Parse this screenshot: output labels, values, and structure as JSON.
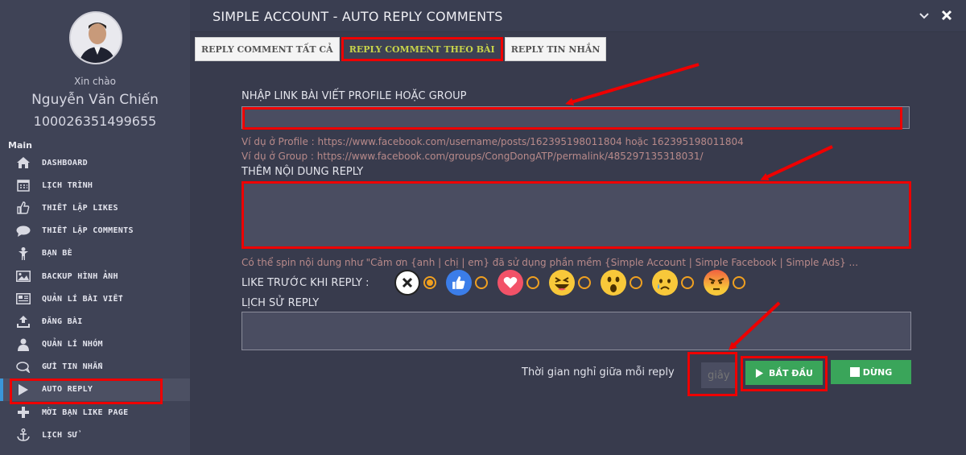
{
  "sidebar": {
    "greeting": "Xin chào",
    "user_name": "Nguyễn Văn Chiến",
    "user_id": "100026351499655",
    "section": "Main",
    "items": [
      {
        "label": "DASHBOARD",
        "icon": "home-icon"
      },
      {
        "label": "LỊCH TRÌNH",
        "icon": "calendar-icon"
      },
      {
        "label": "THIẾT LẬP LIKES",
        "icon": "thumbs-up-icon"
      },
      {
        "label": "THIẾT LẬP COMMENTS",
        "icon": "comment-icon"
      },
      {
        "label": "BẠN BÈ",
        "icon": "person-icon"
      },
      {
        "label": "BACKUP HÌNH ẢNH",
        "icon": "image-icon"
      },
      {
        "label": "QUẢN LÍ BÀI VIẾT",
        "icon": "newspaper-icon"
      },
      {
        "label": "ĐĂNG BÀI",
        "icon": "upload-icon"
      },
      {
        "label": "QUẢN LÍ NHÓM",
        "icon": "user-icon"
      },
      {
        "label": "GỬI TIN NHẮN",
        "icon": "chat-icon"
      },
      {
        "label": "AUTO REPLY",
        "icon": "play-icon"
      },
      {
        "label": "MỜI BẠN LIKE PAGE",
        "icon": "plus-icon"
      },
      {
        "label": "LỊCH SỬ",
        "icon": "anchor-icon"
      }
    ],
    "active_index": 10
  },
  "window": {
    "title": "SIMPLE ACCOUNT - AUTO REPLY COMMENTS"
  },
  "tabs": [
    {
      "label": "REPLY COMMENT TẤT CẢ",
      "active": false
    },
    {
      "label": "REPLY COMMENT THEO BÀI",
      "active": true
    },
    {
      "label": "REPLY TIN NHẮN",
      "active": false
    }
  ],
  "form": {
    "link_label": "NHẬP LINK BÀI VIẾT PROFILE HOẶC GROUP",
    "link_value": "",
    "hint_profile": "Ví dụ ở Profile : https://www.facebook.com/username/posts/162395198011804 hoặc 162395198011804",
    "hint_group": "Ví dụ ở Group : https://www.facebook.com/groups/CongDongATP/permalink/485297135318031/",
    "reply_label": "THÊM NỘI DUNG REPLY",
    "reply_value": "",
    "spin_hint": "Có thể spin nội dung như \"Cảm ơn {anh | chị | em} đã sử dụng phần mềm {Simple Account | Simple Facebook | Simple Ads} ...",
    "like_label": "LIKE TRƯỚC KHI REPLY :",
    "history_label": "LỊCH SỬ REPLY",
    "delay_label": "Thời gian nghỉ giữa mỗi reply",
    "delay_placeholder": "giây",
    "start_label": "BẮT ĐẦU",
    "stop_label": "DỪNG"
  },
  "reactions": [
    {
      "name": "none",
      "icon": "x-circle-icon",
      "selected": true
    },
    {
      "name": "like",
      "icon": "like-reaction-icon",
      "selected": false
    },
    {
      "name": "love",
      "icon": "love-reaction-icon",
      "selected": false
    },
    {
      "name": "haha",
      "icon": "haha-reaction-icon",
      "selected": false
    },
    {
      "name": "wow",
      "icon": "wow-reaction-icon",
      "selected": false
    },
    {
      "name": "sad",
      "icon": "sad-reaction-icon",
      "selected": false
    },
    {
      "name": "angry",
      "icon": "angry-reaction-icon",
      "selected": false
    }
  ],
  "colors": {
    "highlight": "#ee0000",
    "accent_green": "#3aa55a",
    "tab_active_text": "#c7d44a",
    "radio": "#f0a020"
  }
}
